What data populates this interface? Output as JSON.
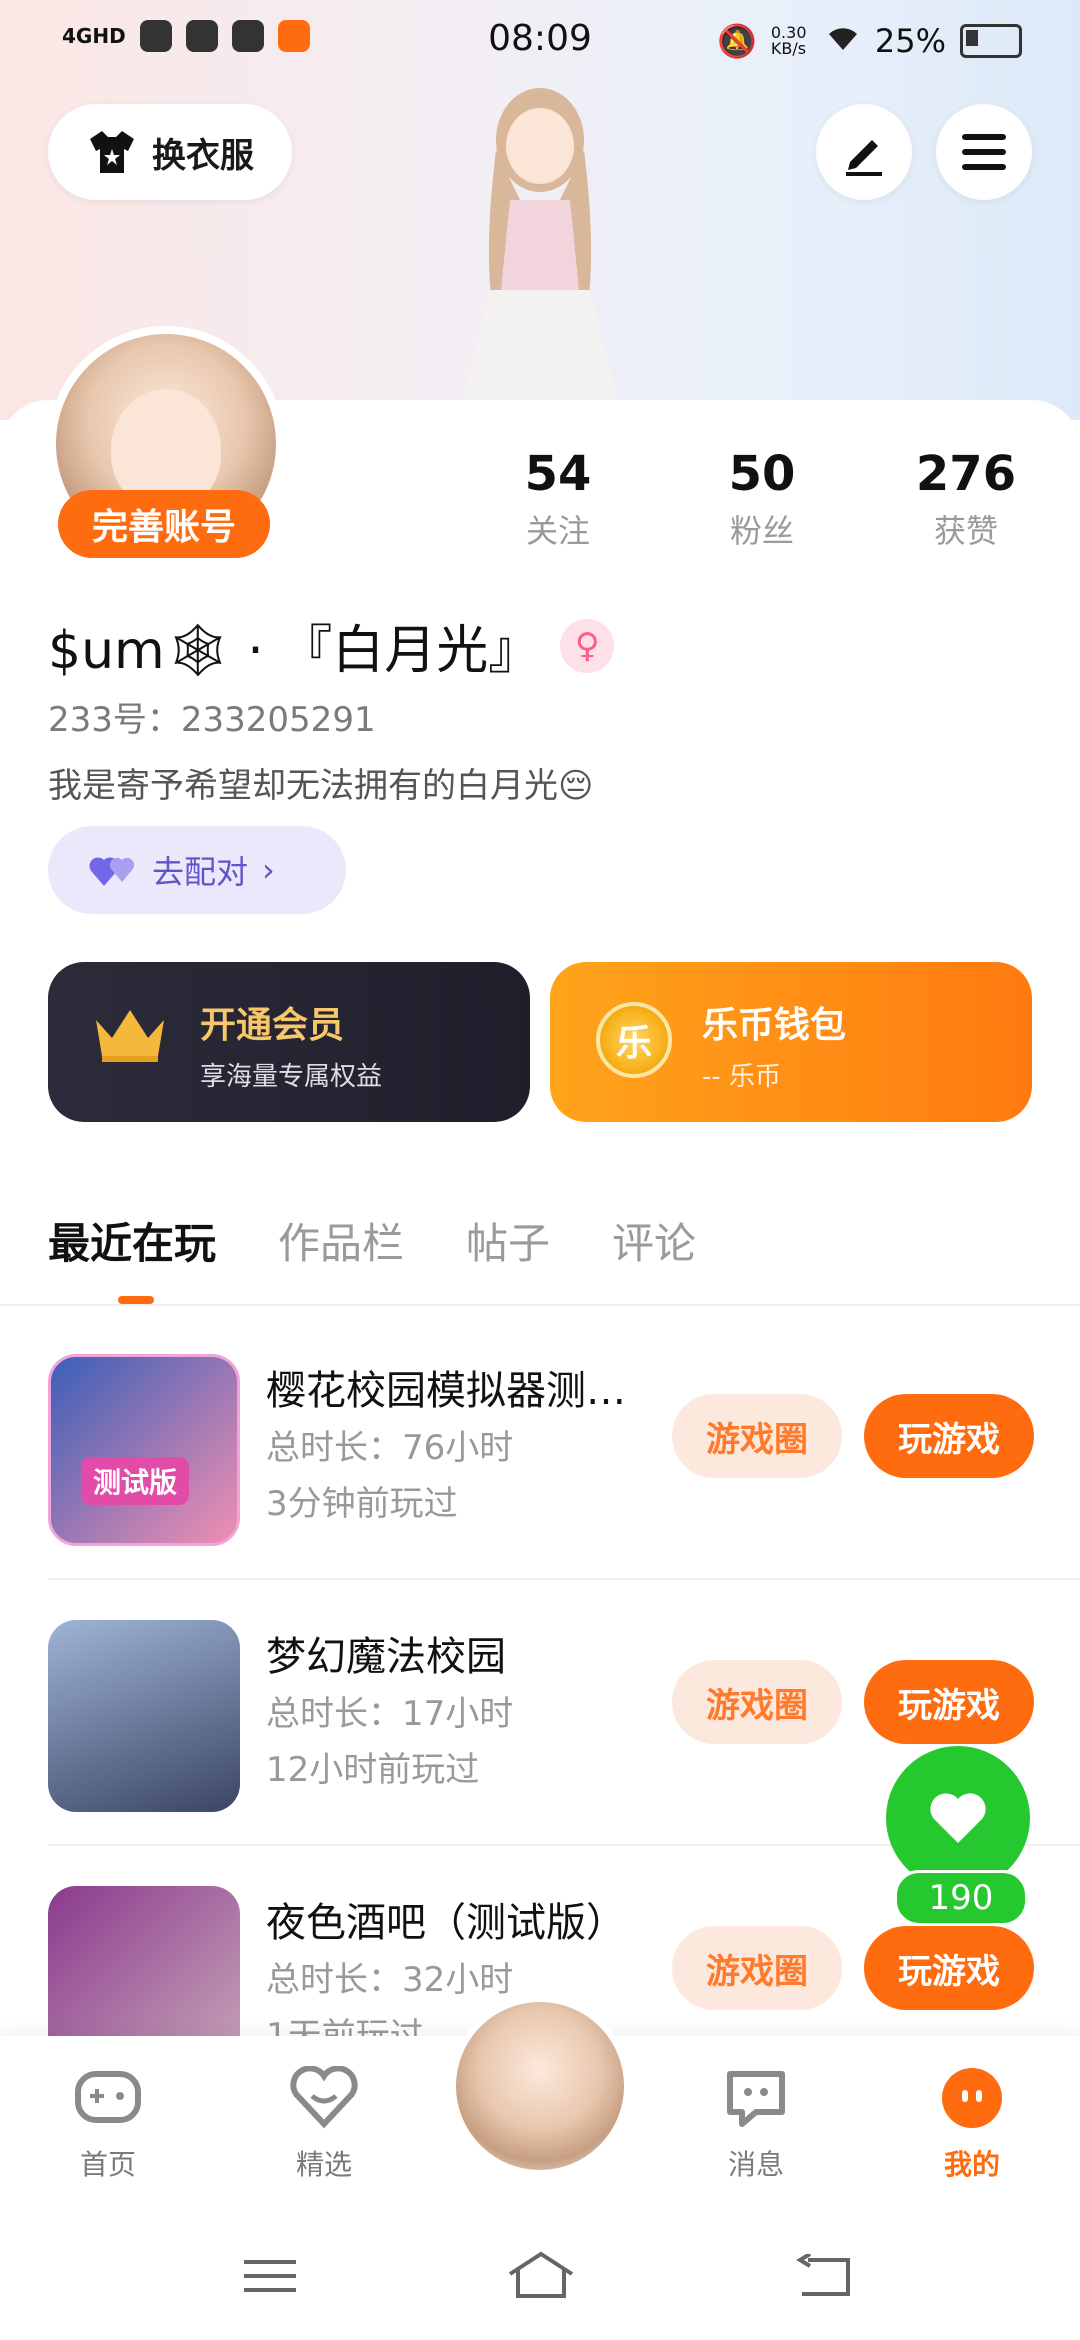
{
  "status_bar": {
    "time": "08:09",
    "network": "4GHD",
    "speed": "0.30 KB/s",
    "battery": "25%"
  },
  "header": {
    "outfit_label": "换衣服"
  },
  "profile": {
    "complete_account_label": "完善账号",
    "stats": [
      {
        "value": "54",
        "label": "关注"
      },
      {
        "value": "50",
        "label": "粉丝"
      },
      {
        "value": "276",
        "label": "获赞"
      }
    ],
    "name": "$um🕸 · 『白月光』",
    "gender_icon": "female-icon",
    "uid": "233号：233205291",
    "bio": "我是寄予希望却无法拥有的白月光😔",
    "match_label": "去配对"
  },
  "promos": {
    "vip": {
      "title": "开通会员",
      "subtitle": "享海量专属权益"
    },
    "wallet": {
      "title": "乐币钱包",
      "subtitle": "-- 乐币",
      "coin": "乐"
    }
  },
  "tabs": [
    "最近在玩",
    "作品栏",
    "帖子",
    "评论"
  ],
  "games": [
    {
      "title": "樱花校园模拟器测…",
      "duration": "总时长：76小时",
      "last_played": "3分钟前玩过",
      "thumb_tag": "测试版",
      "circle_label": "游戏圈",
      "play_label": "玩游戏"
    },
    {
      "title": "梦幻魔法校园",
      "duration": "总时长：17小时",
      "last_played": "12小时前玩过",
      "circle_label": "游戏圈",
      "play_label": "玩游戏"
    },
    {
      "title": "夜色酒吧（测试版）",
      "duration": "总时长：32小时",
      "last_played": "1天前玩过",
      "circle_label": "游戏圈",
      "play_label": "玩游戏"
    }
  ],
  "like": {
    "count": "190"
  },
  "nav": [
    {
      "label": "首页"
    },
    {
      "label": "精选"
    },
    {
      "label": "消息"
    },
    {
      "label": "我的"
    }
  ],
  "colors": {
    "accent": "#ff6b0f",
    "like": "#25c92f"
  }
}
